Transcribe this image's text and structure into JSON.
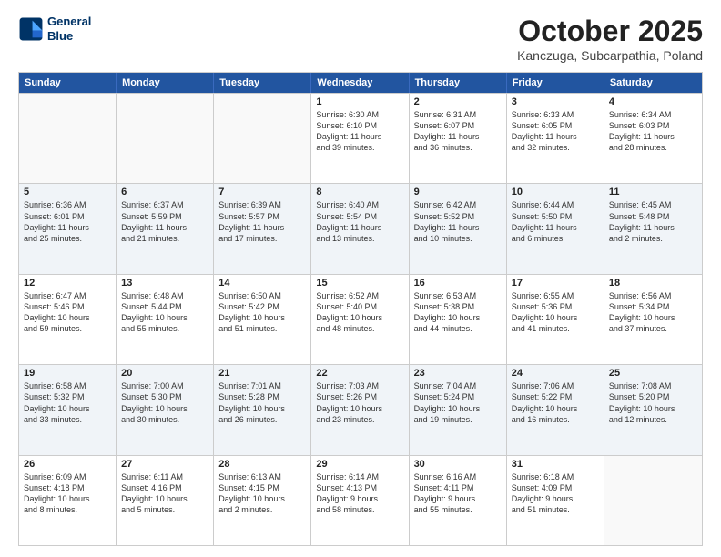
{
  "header": {
    "logo_line1": "General",
    "logo_line2": "Blue",
    "month": "October 2025",
    "location": "Kanczuga, Subcarpathia, Poland"
  },
  "weekdays": [
    "Sunday",
    "Monday",
    "Tuesday",
    "Wednesday",
    "Thursday",
    "Friday",
    "Saturday"
  ],
  "rows": [
    [
      {
        "day": "",
        "info": "",
        "empty": true
      },
      {
        "day": "",
        "info": "",
        "empty": true
      },
      {
        "day": "",
        "info": "",
        "empty": true
      },
      {
        "day": "1",
        "info": "Sunrise: 6:30 AM\nSunset: 6:10 PM\nDaylight: 11 hours\nand 39 minutes.",
        "empty": false
      },
      {
        "day": "2",
        "info": "Sunrise: 6:31 AM\nSunset: 6:07 PM\nDaylight: 11 hours\nand 36 minutes.",
        "empty": false
      },
      {
        "day": "3",
        "info": "Sunrise: 6:33 AM\nSunset: 6:05 PM\nDaylight: 11 hours\nand 32 minutes.",
        "empty": false
      },
      {
        "day": "4",
        "info": "Sunrise: 6:34 AM\nSunset: 6:03 PM\nDaylight: 11 hours\nand 28 minutes.",
        "empty": false
      }
    ],
    [
      {
        "day": "5",
        "info": "Sunrise: 6:36 AM\nSunset: 6:01 PM\nDaylight: 11 hours\nand 25 minutes.",
        "empty": false
      },
      {
        "day": "6",
        "info": "Sunrise: 6:37 AM\nSunset: 5:59 PM\nDaylight: 11 hours\nand 21 minutes.",
        "empty": false
      },
      {
        "day": "7",
        "info": "Sunrise: 6:39 AM\nSunset: 5:57 PM\nDaylight: 11 hours\nand 17 minutes.",
        "empty": false
      },
      {
        "day": "8",
        "info": "Sunrise: 6:40 AM\nSunset: 5:54 PM\nDaylight: 11 hours\nand 13 minutes.",
        "empty": false
      },
      {
        "day": "9",
        "info": "Sunrise: 6:42 AM\nSunset: 5:52 PM\nDaylight: 11 hours\nand 10 minutes.",
        "empty": false
      },
      {
        "day": "10",
        "info": "Sunrise: 6:44 AM\nSunset: 5:50 PM\nDaylight: 11 hours\nand 6 minutes.",
        "empty": false
      },
      {
        "day": "11",
        "info": "Sunrise: 6:45 AM\nSunset: 5:48 PM\nDaylight: 11 hours\nand 2 minutes.",
        "empty": false
      }
    ],
    [
      {
        "day": "12",
        "info": "Sunrise: 6:47 AM\nSunset: 5:46 PM\nDaylight: 10 hours\nand 59 minutes.",
        "empty": false
      },
      {
        "day": "13",
        "info": "Sunrise: 6:48 AM\nSunset: 5:44 PM\nDaylight: 10 hours\nand 55 minutes.",
        "empty": false
      },
      {
        "day": "14",
        "info": "Sunrise: 6:50 AM\nSunset: 5:42 PM\nDaylight: 10 hours\nand 51 minutes.",
        "empty": false
      },
      {
        "day": "15",
        "info": "Sunrise: 6:52 AM\nSunset: 5:40 PM\nDaylight: 10 hours\nand 48 minutes.",
        "empty": false
      },
      {
        "day": "16",
        "info": "Sunrise: 6:53 AM\nSunset: 5:38 PM\nDaylight: 10 hours\nand 44 minutes.",
        "empty": false
      },
      {
        "day": "17",
        "info": "Sunrise: 6:55 AM\nSunset: 5:36 PM\nDaylight: 10 hours\nand 41 minutes.",
        "empty": false
      },
      {
        "day": "18",
        "info": "Sunrise: 6:56 AM\nSunset: 5:34 PM\nDaylight: 10 hours\nand 37 minutes.",
        "empty": false
      }
    ],
    [
      {
        "day": "19",
        "info": "Sunrise: 6:58 AM\nSunset: 5:32 PM\nDaylight: 10 hours\nand 33 minutes.",
        "empty": false
      },
      {
        "day": "20",
        "info": "Sunrise: 7:00 AM\nSunset: 5:30 PM\nDaylight: 10 hours\nand 30 minutes.",
        "empty": false
      },
      {
        "day": "21",
        "info": "Sunrise: 7:01 AM\nSunset: 5:28 PM\nDaylight: 10 hours\nand 26 minutes.",
        "empty": false
      },
      {
        "day": "22",
        "info": "Sunrise: 7:03 AM\nSunset: 5:26 PM\nDaylight: 10 hours\nand 23 minutes.",
        "empty": false
      },
      {
        "day": "23",
        "info": "Sunrise: 7:04 AM\nSunset: 5:24 PM\nDaylight: 10 hours\nand 19 minutes.",
        "empty": false
      },
      {
        "day": "24",
        "info": "Sunrise: 7:06 AM\nSunset: 5:22 PM\nDaylight: 10 hours\nand 16 minutes.",
        "empty": false
      },
      {
        "day": "25",
        "info": "Sunrise: 7:08 AM\nSunset: 5:20 PM\nDaylight: 10 hours\nand 12 minutes.",
        "empty": false
      }
    ],
    [
      {
        "day": "26",
        "info": "Sunrise: 6:09 AM\nSunset: 4:18 PM\nDaylight: 10 hours\nand 8 minutes.",
        "empty": false
      },
      {
        "day": "27",
        "info": "Sunrise: 6:11 AM\nSunset: 4:16 PM\nDaylight: 10 hours\nand 5 minutes.",
        "empty": false
      },
      {
        "day": "28",
        "info": "Sunrise: 6:13 AM\nSunset: 4:15 PM\nDaylight: 10 hours\nand 2 minutes.",
        "empty": false
      },
      {
        "day": "29",
        "info": "Sunrise: 6:14 AM\nSunset: 4:13 PM\nDaylight: 9 hours\nand 58 minutes.",
        "empty": false
      },
      {
        "day": "30",
        "info": "Sunrise: 6:16 AM\nSunset: 4:11 PM\nDaylight: 9 hours\nand 55 minutes.",
        "empty": false
      },
      {
        "day": "31",
        "info": "Sunrise: 6:18 AM\nSunset: 4:09 PM\nDaylight: 9 hours\nand 51 minutes.",
        "empty": false
      },
      {
        "day": "",
        "info": "",
        "empty": true
      }
    ]
  ]
}
